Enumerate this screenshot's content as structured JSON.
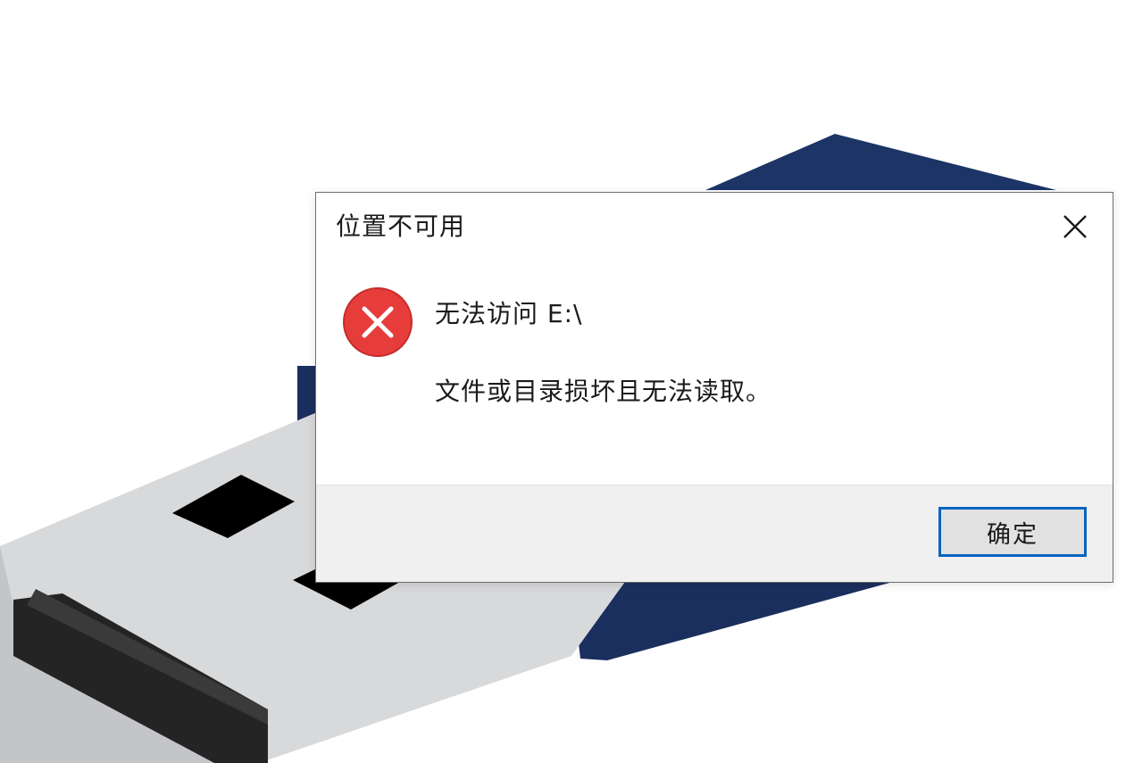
{
  "dialog": {
    "title": "位置不可用",
    "close_icon": "close-icon",
    "error_icon": "error-icon",
    "heading": "无法访问 E:\\",
    "detail": "文件或目录损坏且无法读取。",
    "ok_label": "确定"
  },
  "colors": {
    "error_red": "#e63d3b",
    "usb_navy": "#1b2f5e",
    "button_focus": "#0a64c0"
  }
}
